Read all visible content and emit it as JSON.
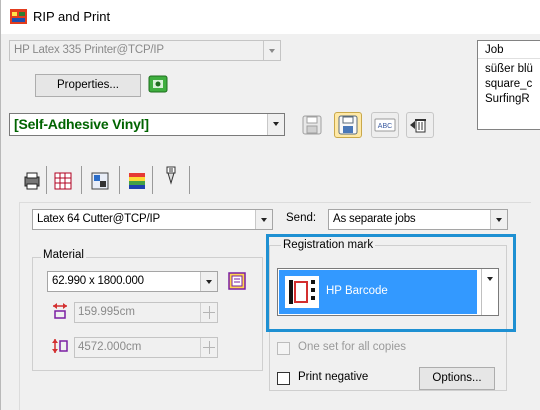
{
  "window": {
    "title": "RIP and Print"
  },
  "printer": {
    "selected": "HP Latex 335 Printer@TCP/IP",
    "properties_label": "Properties..."
  },
  "media": {
    "selected": "[Self-Adhesive Vinyl]"
  },
  "job_list": {
    "header": "Job",
    "rows": [
      "süßer blü",
      "square_c",
      "SurfingR"
    ]
  },
  "cutter": {
    "selected": "Latex 64 Cutter@TCP/IP"
  },
  "send": {
    "label": "Send:",
    "selected": "As separate jobs"
  },
  "material": {
    "group_label": "Material",
    "size_selected": "62.990 x 1800.000",
    "width_value": "159.995cm",
    "length_value": "4572.000cm"
  },
  "registration": {
    "group_label": "Registration mark",
    "selected": "HP Barcode",
    "one_set_label": "One set for all copies",
    "print_negative_label": "Print negative",
    "options_label": "Options..."
  },
  "colors": {
    "highlight": "#1e90d2",
    "selection": "#3399ff",
    "media_text": "#006400"
  }
}
